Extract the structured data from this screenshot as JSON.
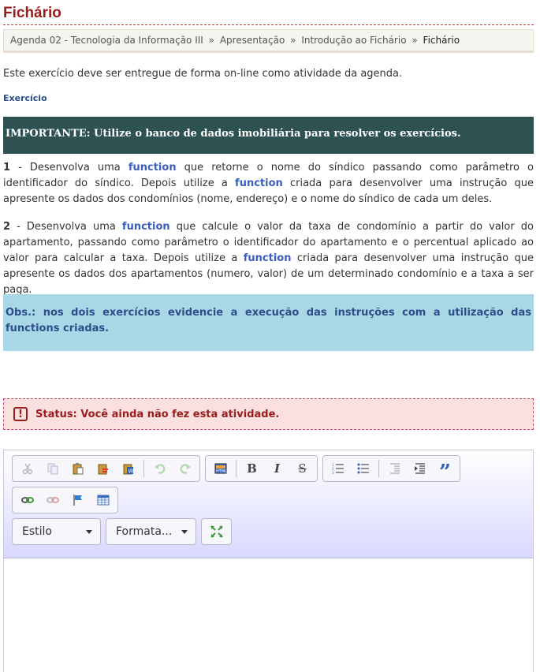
{
  "page": {
    "title": "Fichário"
  },
  "breadcrumb": {
    "items": [
      "Agenda 02 - Tecnologia da Informação III",
      "Apresentação",
      "Introdução ao Fichário"
    ],
    "separator": "»",
    "current": "Fichário"
  },
  "content": {
    "intro": "Este exercício deve ser entregue de forma on-line como atividade da agenda.",
    "exercise_link": "Exercício",
    "important": "IMPORTANTE: Utilize o banco de dados imobiliária para resolver os exercícios.",
    "p1": {
      "num": "1",
      "t1": " - Desenvolva uma ",
      "fn1": "function",
      "t2": " que retorne o nome do síndico passando como parâmetro o identificador do síndico. Depois utilize a ",
      "fn2": "function",
      "t3": " criada para desenvolver uma instrução que apresente os dados dos condomínios (nome, endereço) e o nome do síndico de cada um deles."
    },
    "p2": {
      "num": "2",
      "t1": " - Desenvolva uma ",
      "fn1": "function",
      "t2": " que calcule o valor da taxa de condomínio a partir do valor do apartamento, passando como parâmetro o identificador do apartamento e o percentual aplicado ao valor para calcular a taxa. Depois utilize a ",
      "fn2": "function",
      "t3": " criada para desenvolver uma instrução que apresente os dados dos apartamentos (numero, valor) de um determinado condomínio e a taxa a ser paga."
    },
    "obs": "Obs.: nos dois exercícios evidencie a execução das instruções com a utilização das functions criadas."
  },
  "status": {
    "icon": "!",
    "text": "Status: Você ainda não fez esta atividade."
  },
  "editor": {
    "style_select": "Estilo",
    "format_select": "Formata...",
    "bold": "B",
    "italic": "I",
    "strike": "S",
    "quote": "”",
    "colors": {
      "toolbar_bottom": "#d8d8ff",
      "title": "#9b1c1c",
      "important_bg": "#2e5151",
      "obs_bg": "#a9d7e6",
      "status_bg": "#fbe0e0"
    }
  }
}
